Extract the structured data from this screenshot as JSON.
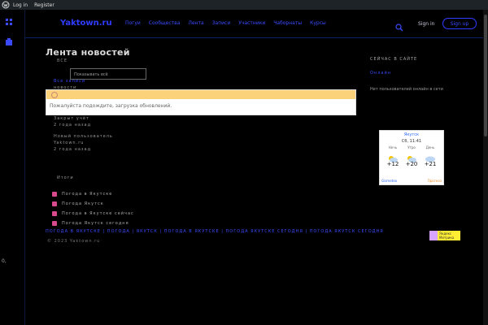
{
  "admin_bar": {
    "login": "Log in",
    "register": "Register"
  },
  "header": {
    "logo": "Yaktown.ru",
    "nav": [
      "Погуи",
      "Сообщества",
      "Лента",
      "Записи",
      "Участники",
      "Чаборнаты",
      "Курсы"
    ],
    "signin": "Sign in",
    "signup": "Sign up"
  },
  "page": {
    "title": "Лента новостей",
    "subtitle": "ВСЕ",
    "dropdown": "Показывать всё",
    "feed": [
      {
        "line1": "Все записи",
        "line2": "новости"
      },
      {
        "line1": "Закрыт учёт",
        "line2": "2 года назад"
      },
      {
        "line1": "Новый пользователь",
        "line2": "Yaktown.ru"
      },
      {
        "line1": "2 года назад",
        "line2": ""
      }
    ],
    "notice": "Пожалуйста подождите, загрузка обновлений."
  },
  "sidebar": {
    "tagline": "СЕЙЧАС В САЙТЕ",
    "online": "Онлайн",
    "empty": "Нет пользователей онлайн\nв сети"
  },
  "weather": {
    "city": "Якутск",
    "time": "Сб, 11:41",
    "periods": [
      {
        "label": "Ночь",
        "temp": "+12"
      },
      {
        "label": "Утро",
        "temp": "+20"
      },
      {
        "label": "День",
        "temp": "+21"
      }
    ],
    "brand": "Gismeteo",
    "forecast": "Прогноз"
  },
  "section": {
    "title": "Итоги",
    "items": [
      "Погода в Якутске",
      "Погода Якутск",
      "Погода в Якутске сейчас",
      "Погода Якутск сегодня"
    ]
  },
  "footer": {
    "links": "ПОГОДА В ЯКУТСКЕ | ПОГОДА | ЯКУТСК | ПОГОДА В ЯКУТСКЕ | ПОГОДА ЯКУТСКЕ СЕГОДНЯ | ПОГОДА ЯКУТСК СЕГОДНЯ",
    "copyright": "© 2023 Yaktown.ru",
    "badge": "Яндекс\nМетрика"
  },
  "leftnote": "0,"
}
